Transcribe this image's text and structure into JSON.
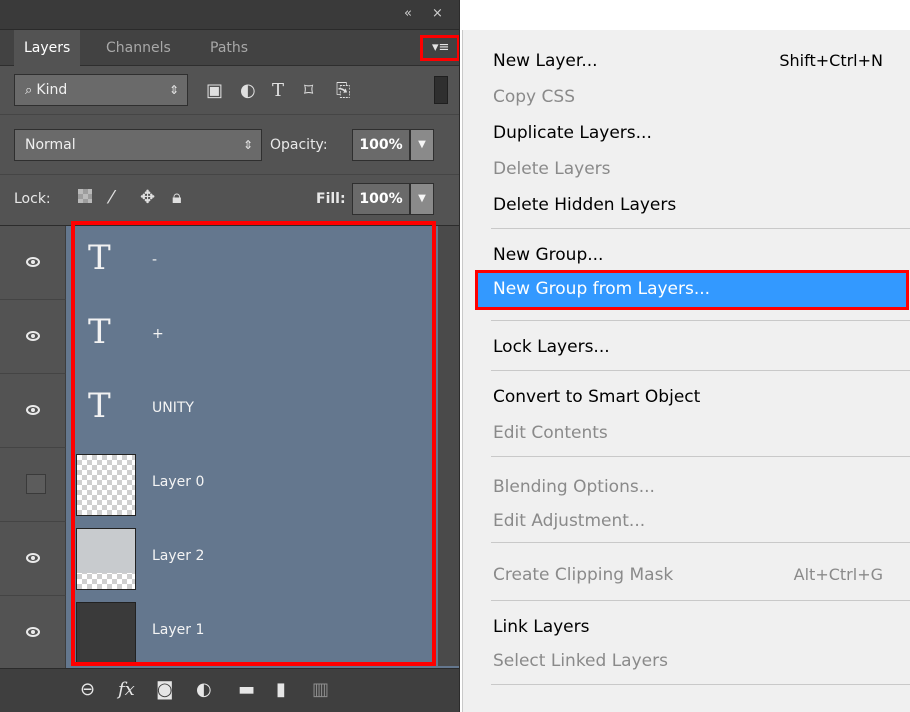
{
  "panel": {
    "title_controls": {
      "collapse": "«",
      "close": "×"
    },
    "tabs": [
      "Layers",
      "Channels",
      "Paths"
    ],
    "menu_glyph": "▾≡",
    "filter": {
      "label": "Kind",
      "icons": [
        "image-filter-icon",
        "adjustment-filter-icon",
        "type-filter-icon",
        "shape-filter-icon",
        "smart-object-filter-icon"
      ]
    },
    "blend_mode": "Normal",
    "opacity_label": "Opacity:",
    "opacity_value": "100%",
    "lock_label": "Lock:",
    "fill_label": "Fill:",
    "fill_value": "100%",
    "layers": [
      {
        "name": "-",
        "kind": "type",
        "visible": true
      },
      {
        "name": "+",
        "kind": "type",
        "visible": true
      },
      {
        "name": "UNITY",
        "kind": "type",
        "visible": true
      },
      {
        "name": "Layer 0",
        "kind": "transparent",
        "visible": false
      },
      {
        "name": "Layer 2",
        "kind": "partial",
        "visible": true
      },
      {
        "name": "Layer 1",
        "kind": "dark",
        "visible": true
      }
    ],
    "type_glyph": "T"
  },
  "menu": {
    "items": [
      {
        "label": "New Layer...",
        "shortcut": "Shift+Ctrl+N",
        "enabled": true
      },
      {
        "label": "Copy CSS",
        "enabled": false
      },
      {
        "label": "Duplicate Layers...",
        "enabled": true
      },
      {
        "label": "Delete Layers",
        "enabled": false
      },
      {
        "label": "Delete Hidden Layers",
        "enabled": true
      },
      {
        "label": "New Group...",
        "enabled": true
      },
      {
        "label": "New Group from Layers...",
        "enabled": true,
        "highlighted": true
      },
      {
        "label": "Lock Layers...",
        "enabled": true
      },
      {
        "label": "Convert to Smart Object",
        "enabled": true
      },
      {
        "label": "Edit Contents",
        "enabled": false
      },
      {
        "label": "Blending Options...",
        "enabled": false
      },
      {
        "label": "Edit Adjustment...",
        "enabled": false
      },
      {
        "label": "Create Clipping Mask",
        "shortcut": "Alt+Ctrl+G",
        "enabled": false
      },
      {
        "label": "Link Layers",
        "enabled": true
      },
      {
        "label": "Select Linked Layers",
        "enabled": false
      }
    ]
  },
  "colors": {
    "selection": "#64778e",
    "highlight": "#3399ff",
    "annotation": "#ff0000"
  }
}
